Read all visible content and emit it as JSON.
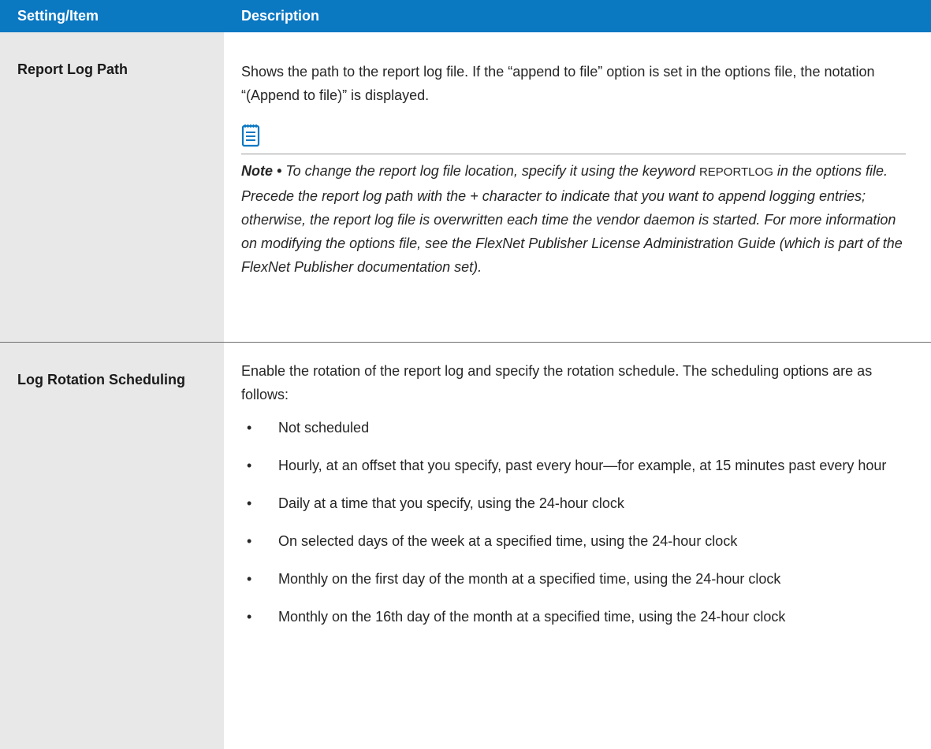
{
  "table": {
    "header": {
      "col1": "Setting/Item",
      "col2": "Description"
    },
    "rows": [
      {
        "setting": "Report Log Path",
        "description": "Shows the path to the report log file. If the “append to file” option is set in the options file, the notation “(Append to file)” is displayed.",
        "note": {
          "icon": "notepad-icon",
          "label": "Note •",
          "text_before_code": " To change the report log file location, specify it using the keyword ",
          "code": "REPORTLOG",
          "text_after_code": " in the options file. Precede the report log path with the + character to indicate that you want to append logging entries; otherwise, the report log file is overwritten each time the vendor daemon is started. For more information on modifying the options file, see the FlexNet Publisher License Administration Guide (which is part of the FlexNet Publisher documentation set)."
        }
      },
      {
        "setting": "Log Rotation Scheduling",
        "description": "Enable the rotation of the report log and specify the rotation schedule. The scheduling options are as follows:",
        "bullets": [
          "Not scheduled",
          "Hourly, at an offset that you specify, past every hour—for example, at 15 minutes past every hour",
          "Daily at a time that you specify, using the 24-hour clock",
          "On selected days of the week at a specified time, using the 24-hour clock",
          "Monthly on the first day of the month at a specified time, using the 24-hour clock",
          "Monthly on the 16th day of the month at a specified time, using the 24-hour clock"
        ]
      }
    ]
  },
  "colors": {
    "header_bg": "#0b78c2",
    "setting_col_bg": "#e8e8e8"
  }
}
